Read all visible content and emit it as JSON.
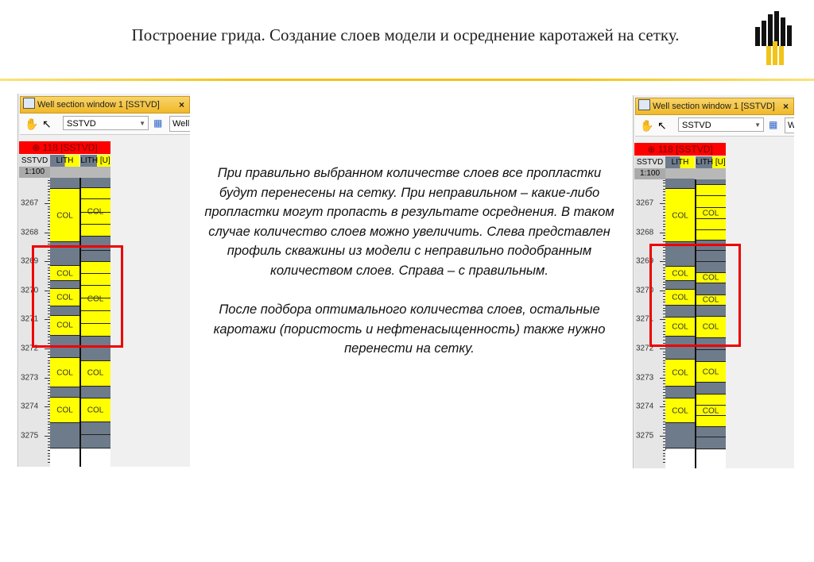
{
  "slide": {
    "title": "Построение грида. Создание слоев модели и осреднение каротажей на сетку.",
    "paragraphs": [
      "При правильно выбранном количестве слоев все пропластки будут перенесены на сетку. При неправильном – какие-либо пропластки могут пропасть в результате осреднения. В таком случае количество слоев можно увеличить. Слева представлен профиль скважины из модели с неправильно подобранным количеством слоев. Справа – с правильным.",
      "После подбора оптимального количества слоев, остальные каротажи (пористость и нефтенасыщенность) также нужно перенести на сетку."
    ]
  },
  "colors": {
    "yellow": "#ffff00",
    "gray": "#6e7b8b",
    "red": "#e00000",
    "accent": "#f2c418"
  },
  "window": {
    "title": "Well section window 1 [SSTVD]",
    "close": "×",
    "combo": "SSTVD",
    "well": "Well",
    "well_header": "⊕ 118 [SSTVD]",
    "col_depth": "SSTVD",
    "col_lith": "LITH",
    "col_lith_u": "LITH [U]",
    "scale": "1:100",
    "depth_labels": [
      3267,
      3268,
      3269,
      3270,
      3271,
      3272,
      3273,
      3274,
      3275
    ]
  },
  "panels": [
    {
      "name": "left",
      "lith": [
        [
          3266.13,
          3266.51,
          "g"
        ],
        [
          3266.51,
          3268.34,
          "y",
          "COL"
        ],
        [
          3268.34,
          3269.16,
          "g"
        ],
        [
          3269.16,
          3269.68,
          "y",
          "COL"
        ],
        [
          3269.68,
          3269.95,
          "g"
        ],
        [
          3269.95,
          3270.55,
          "y",
          "COL"
        ],
        [
          3270.55,
          3270.88,
          "g"
        ],
        [
          3270.88,
          3271.56,
          "y",
          "COL"
        ],
        [
          3271.56,
          3272.33,
          "g"
        ],
        [
          3272.33,
          3273.34,
          "y",
          "COL"
        ],
        [
          3273.34,
          3273.69,
          "g"
        ],
        [
          3273.69,
          3274.57,
          "y",
          "COL"
        ],
        [
          3274.57,
          3275.44,
          "g"
        ]
      ],
      "lith_u": [
        [
          3266.13,
          3266.48,
          "g"
        ],
        [
          3266.48,
          3266.86,
          "y"
        ],
        [
          3266.86,
          3267.33,
          "y"
        ],
        [
          3267.33,
          3267.74,
          "y"
        ],
        [
          3267.74,
          3268.15,
          "y"
        ],
        [
          3268.15,
          3268.64,
          "g"
        ],
        [
          3268.64,
          3269.02,
          "g"
        ],
        [
          3269.02,
          3269.43,
          "y"
        ],
        [
          3269.43,
          3269.84,
          "y"
        ],
        [
          3269.84,
          3270.28,
          "y"
        ],
        [
          3270.28,
          3270.72,
          "y"
        ],
        [
          3270.72,
          3271.15,
          "y"
        ],
        [
          3271.15,
          3271.59,
          "y"
        ],
        [
          3271.59,
          3271.97,
          "g"
        ],
        [
          3271.97,
          3272.44,
          "g"
        ],
        [
          3272.44,
          3273.31,
          "y"
        ],
        [
          3273.31,
          3273.72,
          "g"
        ],
        [
          3273.72,
          3274.54,
          "y"
        ],
        [
          3274.54,
          3274.98,
          "g"
        ],
        [
          3274.98,
          3275.44,
          "g"
        ]
      ],
      "lith_u_labels": [
        [
          "COL",
          3267.3
        ],
        [
          "COL",
          3270.31
        ],
        [
          "COL",
          3272.85
        ],
        [
          "COL",
          3274.14
        ]
      ]
    },
    {
      "name": "right",
      "lith": [
        [
          3266.16,
          3266.51,
          "g"
        ],
        [
          3266.51,
          3268.34,
          "y",
          "COL"
        ],
        [
          3268.34,
          3269.19,
          "g"
        ],
        [
          3269.19,
          3269.68,
          "y",
          "COL"
        ],
        [
          3269.68,
          3269.98,
          "g"
        ],
        [
          3269.98,
          3270.52,
          "y",
          "COL"
        ],
        [
          3270.52,
          3270.93,
          "g"
        ],
        [
          3270.93,
          3271.59,
          "y",
          "COL"
        ],
        [
          3271.59,
          3272.38,
          "g"
        ],
        [
          3272.38,
          3273.31,
          "y",
          "COL"
        ],
        [
          3273.31,
          3273.72,
          "g"
        ],
        [
          3273.72,
          3274.57,
          "y",
          "COL"
        ],
        [
          3274.57,
          3275.44,
          "g"
        ]
      ],
      "lith_u": [
        [
          3266.18,
          3266.37,
          "g"
        ],
        [
          3266.37,
          3266.75,
          "y"
        ],
        [
          3266.75,
          3267.16,
          "y"
        ],
        [
          3267.16,
          3267.55,
          "y",
          "COL"
        ],
        [
          3267.55,
          3267.93,
          "y"
        ],
        [
          3267.93,
          3268.28,
          "y"
        ],
        [
          3268.28,
          3268.64,
          "g"
        ],
        [
          3268.64,
          3269.02,
          "g"
        ],
        [
          3269.02,
          3269.4,
          "g"
        ],
        [
          3269.4,
          3269.76,
          "y",
          "COL"
        ],
        [
          3269.76,
          3270.17,
          "g"
        ],
        [
          3270.17,
          3270.52,
          "y",
          "COL"
        ],
        [
          3270.52,
          3270.91,
          "g"
        ],
        [
          3270.91,
          3271.64,
          "y",
          "COL"
        ],
        [
          3271.64,
          3272.05,
          "g"
        ],
        [
          3272.05,
          3272.46,
          "g"
        ],
        [
          3272.46,
          3273.17,
          "y",
          "COL"
        ],
        [
          3273.17,
          3273.58,
          "g"
        ],
        [
          3273.58,
          3273.97,
          "y"
        ],
        [
          3273.97,
          3274.32,
          "y",
          "COL"
        ],
        [
          3274.32,
          3274.7,
          "y"
        ],
        [
          3274.7,
          3275.06,
          "g"
        ],
        [
          3275.06,
          3275.47,
          "g"
        ]
      ],
      "lith_u_labels": []
    }
  ]
}
